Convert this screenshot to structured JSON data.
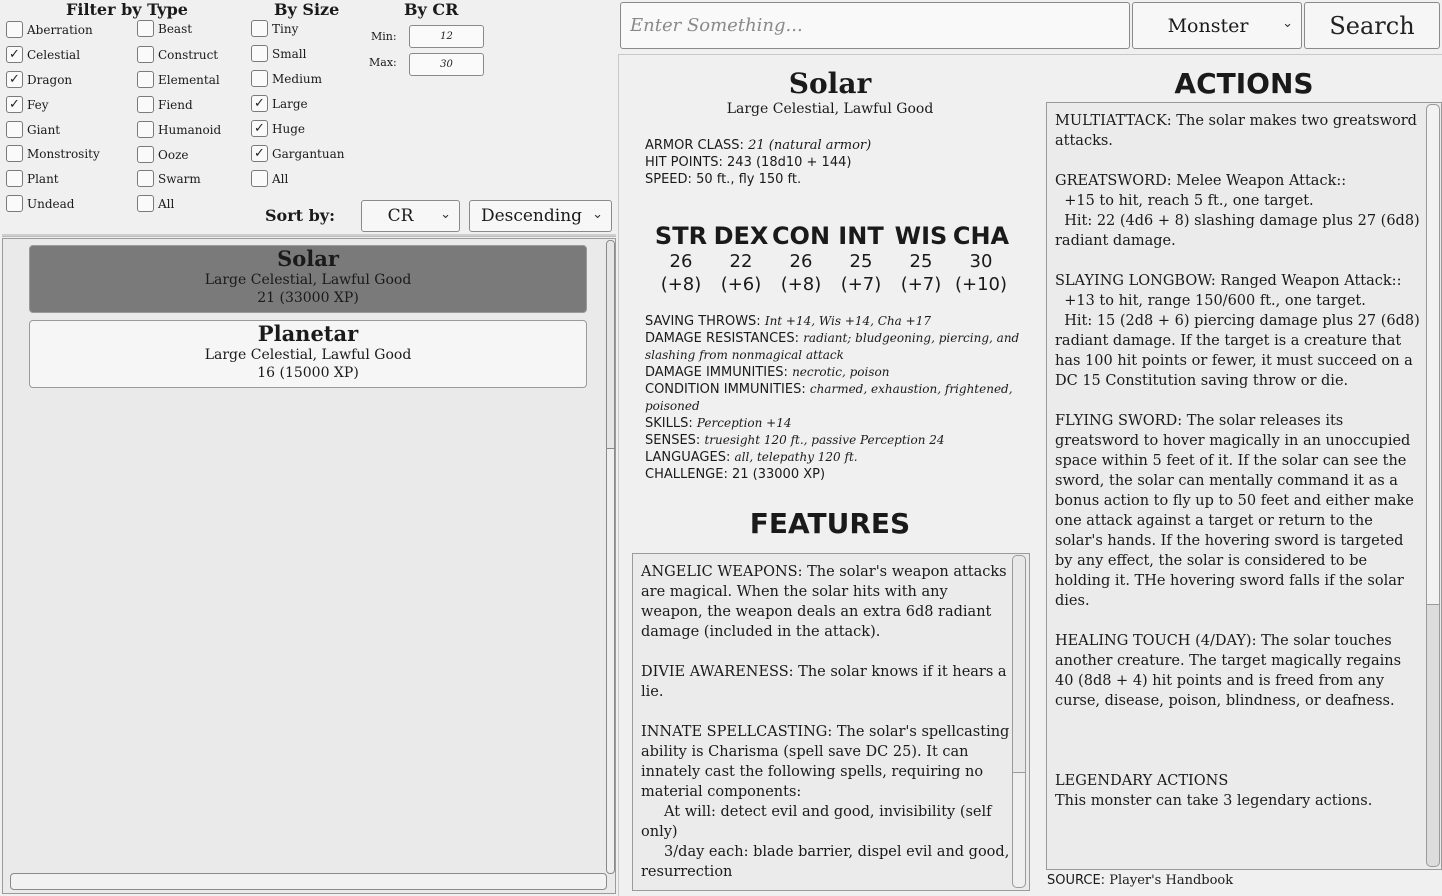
{
  "filters": {
    "type_title": "Filter by Type",
    "size_title": "By Size",
    "cr_title": "By CR",
    "types": [
      {
        "label": "Aberration",
        "checked": false
      },
      {
        "label": "Celestial",
        "checked": true
      },
      {
        "label": "Dragon",
        "checked": true
      },
      {
        "label": "Fey",
        "checked": true
      },
      {
        "label": "Giant",
        "checked": false
      },
      {
        "label": "Monstrosity",
        "checked": false
      },
      {
        "label": "Plant",
        "checked": false
      },
      {
        "label": "Undead",
        "checked": false
      },
      {
        "label": "Beast",
        "checked": false
      },
      {
        "label": "Construct",
        "checked": false
      },
      {
        "label": "Elemental",
        "checked": false
      },
      {
        "label": "Fiend",
        "checked": false
      },
      {
        "label": "Humanoid",
        "checked": false
      },
      {
        "label": "Ooze",
        "checked": false
      },
      {
        "label": "Swarm",
        "checked": false
      },
      {
        "label": "All",
        "checked": false
      }
    ],
    "sizes": [
      {
        "label": "Tiny",
        "checked": false
      },
      {
        "label": "Small",
        "checked": false
      },
      {
        "label": "Medium",
        "checked": false
      },
      {
        "label": "Large",
        "checked": true
      },
      {
        "label": "Huge",
        "checked": true
      },
      {
        "label": "Gargantuan",
        "checked": true
      },
      {
        "label": "All",
        "checked": false
      }
    ],
    "cr_min_label": "Min:",
    "cr_min": "12",
    "cr_max_label": "Max:",
    "cr_max": "30",
    "sort_label": "Sort by:",
    "sort_field": "CR",
    "sort_order": "Descending"
  },
  "results": [
    {
      "name": "Solar",
      "type": "Large Celestial, Lawful Good",
      "cr": "21 (33000 XP)",
      "selected": true
    },
    {
      "name": "Planetar",
      "type": "Large Celestial, Lawful Good",
      "cr": "16 (15000 XP)",
      "selected": false
    }
  ],
  "search": {
    "placeholder": "Enter Something...",
    "value": "",
    "category": "Monster",
    "button_label": "Search"
  },
  "monster": {
    "name": "Solar",
    "type": "Large Celestial, Lawful Good",
    "armor_class_label": "ARMOR CLASS:",
    "armor_class": "21 (natural armor)",
    "hit_points_label": "HIT POINTS:",
    "hit_points": "243 (18d10 + 144)",
    "speed_label": "SPEED:",
    "speed": "50 ft., fly 150 ft.",
    "abilities": [
      {
        "name": "STR",
        "score": "26",
        "mod": "(+8)"
      },
      {
        "name": "DEX",
        "score": "22",
        "mod": "(+6)"
      },
      {
        "name": "CON",
        "score": "26",
        "mod": "(+8)"
      },
      {
        "name": "INT",
        "score": "25",
        "mod": "(+7)"
      },
      {
        "name": "WIS",
        "score": "25",
        "mod": "(+7)"
      },
      {
        "name": "CHA",
        "score": "30",
        "mod": "(+10)"
      }
    ],
    "properties": [
      {
        "label": "SAVING THROWS:",
        "value": "Int +14, Wis +14, Cha +17"
      },
      {
        "label": "DAMAGE RESISTANCES:",
        "value": "radiant; bludgeoning, piercing, and slashing from nonmagical attack"
      },
      {
        "label": "DAMAGE IMMUNITIES:",
        "value": "necrotic, poison"
      },
      {
        "label": "CONDITION IMMUNITIES:",
        "value": "charmed, exhaustion, frightened, poisoned"
      },
      {
        "label": "SKILLS:",
        "value": "Perception +14"
      },
      {
        "label": "SENSES:",
        "value": "truesight 120 ft., passive Perception 24"
      },
      {
        "label": "LANGUAGES:",
        "value": "all, telepathy 120 ft."
      },
      {
        "label": "CHALLENGE:",
        "value": "21 (33000 XP)"
      }
    ],
    "features_title": "FEATURES",
    "features_text": "ANGELIC WEAPONS: The solar's weapon attacks are magical. When the solar hits with any weapon, the weapon deals an extra 6d8 radiant damage (included in the attack).\n\nDIVIE AWARENESS: The solar knows if it hears a lie.\n\nINNATE SPELLCASTING: The solar's spellcasting ability is Charisma (spell save DC 25). It can innately cast the following spells, requiring no material components:\n     At will: detect evil and good, invisibility (self only)\n     3/day each: blade barrier, dispel evil and good, resurrection",
    "actions_title": "ACTIONS",
    "actions_text": "MULTIATTACK: The solar makes two greatsword attacks.\n\nGREATSWORD: Melee Weapon Attack::\n  +15 to hit, reach 5 ft., one target.\n  Hit: 22 (4d6 + 8) slashing damage plus 27 (6d8) radiant damage.\n\nSLAYING LONGBOW: Ranged Weapon Attack::\n  +13 to hit, range 150/600 ft., one target.\n  Hit: 15 (2d8 + 6) piercing damage plus 27 (6d8) radiant damage. If the target is a creature that has 100 hit points or fewer, it must succeed on a DC 15 Constitution saving throw or die.\n\nFLYING SWORD: The solar releases its greatsword to hover magically in an unoccupied space within 5 feet of it. If the solar can see the sword, the solar can mentally command it as a bonus action to fly up to 50 feet and either make one attack against a target or return to the solar's hands. If the hovering sword is targeted by any effect, the solar is considered to be holding it. THe hovering sword falls if the solar dies.\n\nHEALING TOUCH (4/DAY): The solar touches another creature. The target magically regains 40 (8d8 + 4) hit points and is freed from any curse, disease, poison, blindness, or deafness.\n\n\n\nLEGENDARY ACTIONS\nThis monster can take 3 legendary actions.",
    "source_label": "SOURCE:",
    "source": "Player's Handbook"
  }
}
